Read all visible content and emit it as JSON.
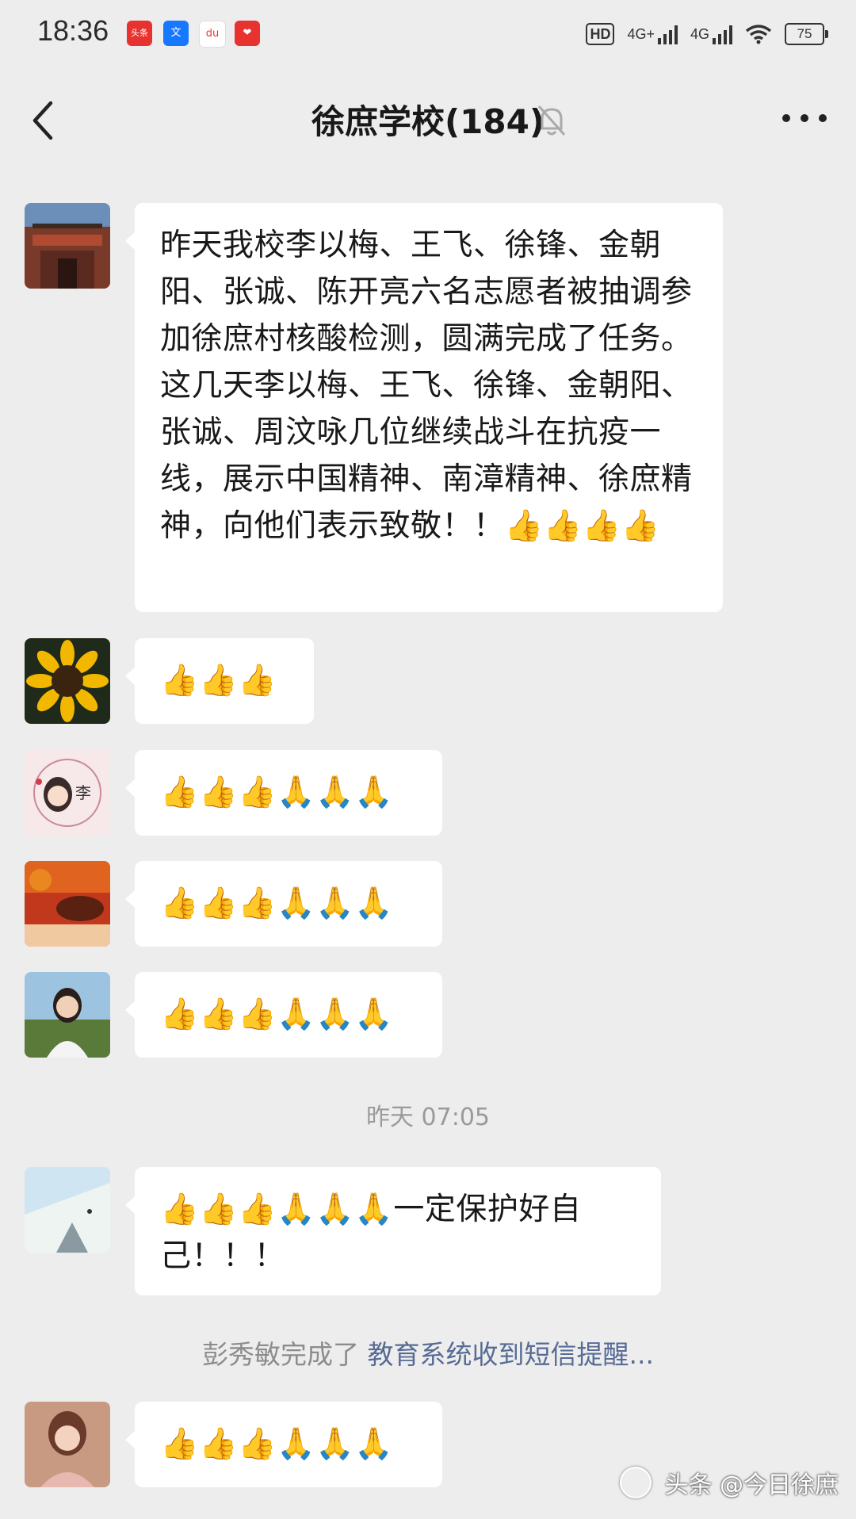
{
  "status_bar": {
    "time": "18:36",
    "app_icons": [
      "头条",
      "文",
      "du",
      "❤"
    ],
    "hd_label": "HD",
    "net1": "4G+",
    "net2": "4G",
    "battery": "75"
  },
  "header": {
    "title": "徐庶学校(184)",
    "back_icon": "chevron-left-icon",
    "mute_icon": "bell-off-icon",
    "more_icon": "more-dots-icon"
  },
  "messages": [
    {
      "text": "昨天我校李以梅、王飞、徐锋、金朝阳、张诚、陈开亮六名志愿者被抽调参加徐庶村核酸检测，圆满完成了任务。这几天李以梅、王飞、徐锋、金朝阳、张诚、周汶咏几位继续战斗在抗疫一线，展示中国精神、南漳精神、徐庶精神，向他们表示致敬！！👍👍👍👍"
    },
    {
      "text": "👍👍👍"
    },
    {
      "text": "👍👍👍🙏🙏🙏"
    },
    {
      "text": "👍👍👍🙏🙏🙏"
    },
    {
      "text": "👍👍👍🙏🙏🙏"
    },
    {
      "text": "👍👍👍🙏🙏🙏一定保护好自己！！！"
    },
    {
      "text": "👍👍👍🙏🙏🙏"
    }
  ],
  "timestamp": "昨天 07:05",
  "system_message": {
    "prefix": "彭秀敏完成了 ",
    "link": "教育系统收到短信提醒..."
  },
  "avatar_labels": {
    "avatar3": "李"
  },
  "watermark": "头条 @今日徐庶"
}
